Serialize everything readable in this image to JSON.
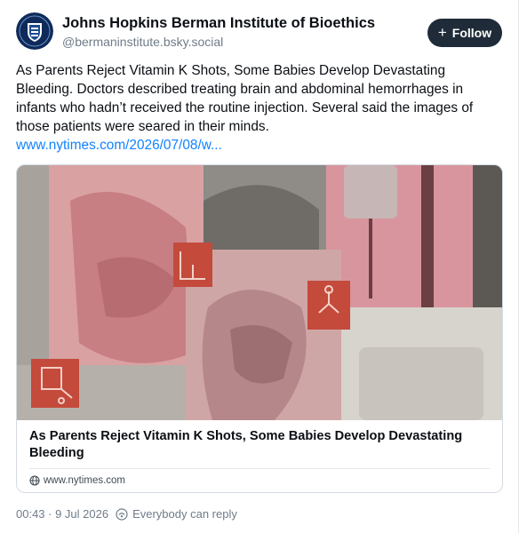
{
  "author": {
    "display_name": "Johns Hopkins Berman Institute of Bioethics",
    "handle": "@bermaninstitute.bsky.social",
    "avatar_icon": "university-shield-logo"
  },
  "follow": {
    "label": "Follow",
    "icon": "plus-icon"
  },
  "post": {
    "text": "As Parents Reject Vitamin K Shots, Some Babies Develop Devastating Bleeding. Doctors described treating brain and abdominal hemorrhages in infants who hadn’t received the routine injection. Several said the images of those patients were seared in their minds.",
    "link": "www.nytimes.com/2026/07/08/w..."
  },
  "card": {
    "title": "As Parents Reject Vitamin K Shots, Some Babies Develop Devastating Bleeding",
    "domain": "www.nytimes.com",
    "domain_icon": "globe-icon"
  },
  "meta": {
    "timestamp": "00:43 · 9 Jul 2026",
    "reply_setting": "Everybody can reply",
    "reply_icon": "reply-audience-icon"
  },
  "colors": {
    "link": "#1083fe",
    "follow_bg": "#1f2b38",
    "muted_text": "#6f7c89",
    "collage_red": "#c44a3c",
    "collage_pink": "#d98b93"
  }
}
